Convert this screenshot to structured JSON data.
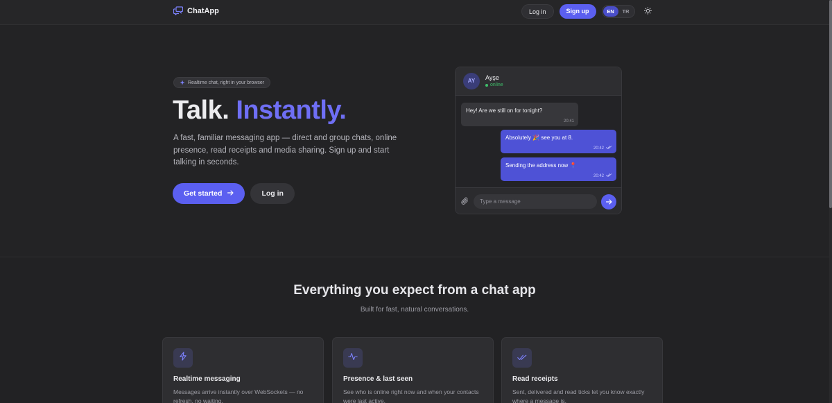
{
  "header": {
    "brand": "ChatApp",
    "login_label": "Log in",
    "signup_label": "Sign up",
    "languages": [
      "EN",
      "TR"
    ],
    "active_language": "EN"
  },
  "hero": {
    "pill": "Realtime chat, right in your browser",
    "title_part1": "Talk.",
    "title_part2": "Instantly.",
    "description": "A fast, familiar messaging app — direct and group chats, online presence, read receipts and media sharing. Sign up and start talking in seconds.",
    "primary_cta": "Get started",
    "secondary_cta": "Log in"
  },
  "chat_preview": {
    "contact_initials": "AY",
    "contact_name": "Ayşe",
    "contact_status": "online",
    "messages": [
      {
        "direction": "in",
        "text": "Hey! Are we still on for tonight?",
        "time": "20:41"
      },
      {
        "direction": "out",
        "text": "Absolutely 🎉 see you at 8.",
        "time": "20:42",
        "read": true
      },
      {
        "direction": "out",
        "text": "Sending the address now 📍",
        "time": "20:42",
        "read": true
      }
    ],
    "input_placeholder": "Type a message"
  },
  "features": {
    "title": "Everything you expect from a chat app",
    "subtitle": "Built for fast, natural conversations.",
    "cards": [
      {
        "icon": "lightning-icon",
        "title": "Realtime messaging",
        "desc": "Messages arrive instantly over WebSockets — no refresh, no waiting."
      },
      {
        "icon": "pulse-icon",
        "title": "Presence & last seen",
        "desc": "See who is online right now and when your contacts were last active."
      },
      {
        "icon": "double-check-icon",
        "title": "Read receipts",
        "desc": "Sent, delivered and read ticks let you know exactly where a message is."
      }
    ]
  },
  "colors": {
    "accent": "#5b5ff0",
    "accent_text": "#6f6ff5",
    "background": "#232325",
    "online": "#3fbf6a"
  }
}
